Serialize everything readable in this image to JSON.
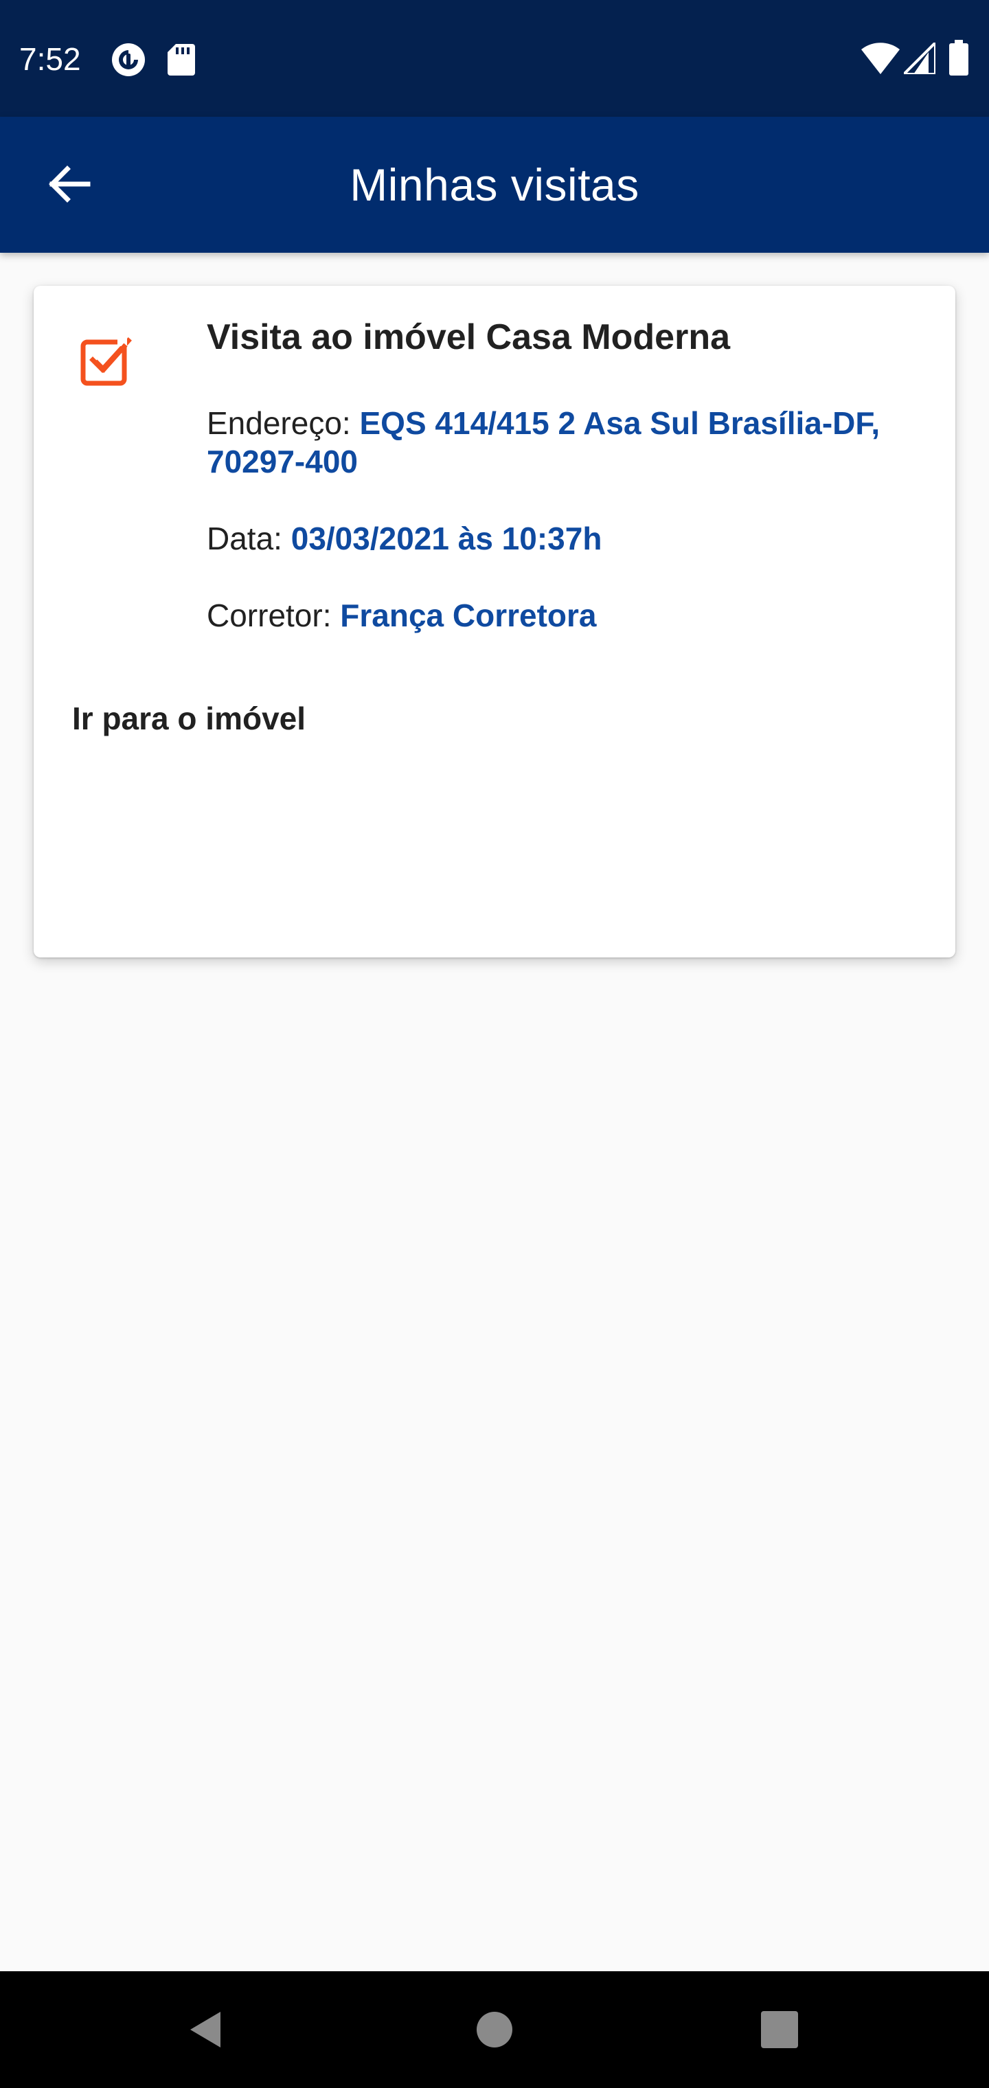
{
  "status_bar": {
    "time": "7:52",
    "icons": [
      "pocket-casts-icon",
      "sd-card-icon",
      "wifi-icon",
      "signal-icon",
      "battery-icon"
    ]
  },
  "app_bar": {
    "title": "Minhas visitas",
    "back_icon": "arrow-back-icon"
  },
  "visit": {
    "icon": "checkbox-checked-icon",
    "title": "Visita ao imóvel Casa Moderna",
    "address_label": "Endereço: ",
    "address_value": "EQS 414/415 2 Asa Sul Brasília-DF, 70297-400",
    "date_label": "Data: ",
    "date_value": "03/03/2021 às 10:37h",
    "broker_label": "Corretor: ",
    "broker_value": "França Corretora",
    "link_label": "Ir para o imóvel"
  },
  "nav_bar": {
    "icons": [
      "back-triangle-icon",
      "home-circle-icon",
      "recents-square-icon"
    ]
  },
  "colors": {
    "status_bar": "#04214f",
    "app_bar": "#012c6e",
    "accent_orange": "#f4511e",
    "value_blue": "#0f4aa0",
    "background": "#fafafa"
  }
}
